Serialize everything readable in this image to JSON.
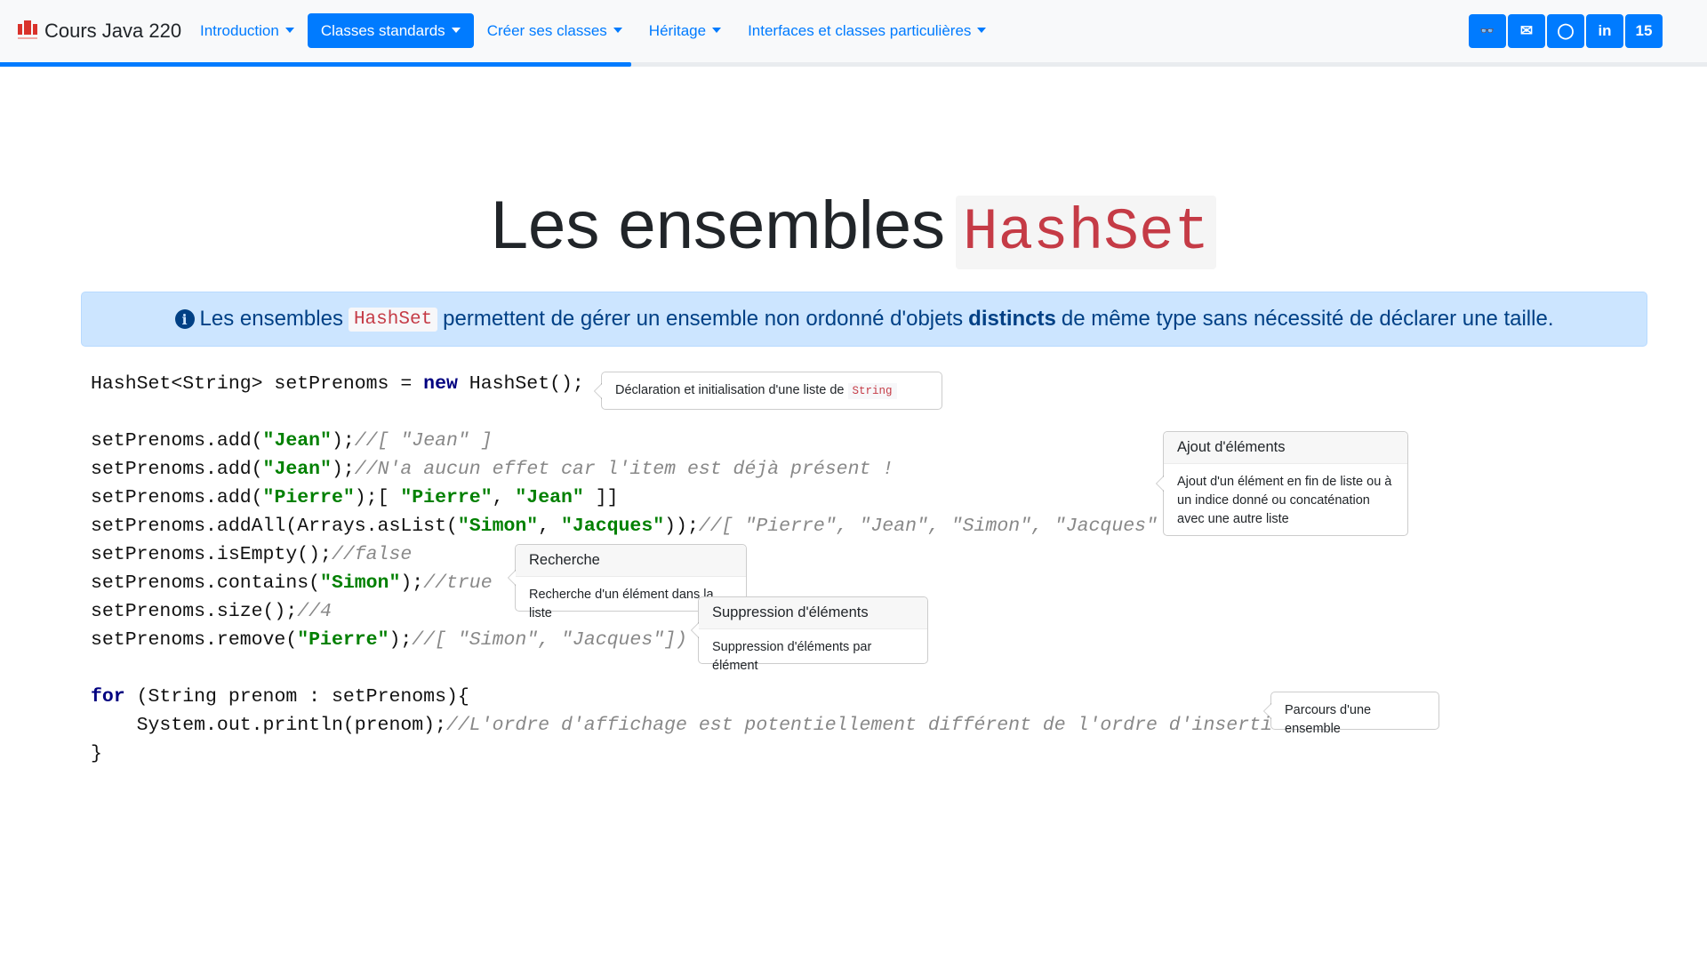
{
  "nav": {
    "brand": "Cours Java 220",
    "links": [
      {
        "label": "Introduction",
        "active": false
      },
      {
        "label": "Classes standards",
        "active": true
      },
      {
        "label": "Créer ses classes",
        "active": false
      },
      {
        "label": "Héritage",
        "active": false
      },
      {
        "label": "Interfaces et classes particulières",
        "active": false
      }
    ],
    "buttons": [
      {
        "icon": "glasses-icon",
        "glyph": "👓"
      },
      {
        "icon": "envelope-icon",
        "glyph": "✉"
      },
      {
        "icon": "github-icon",
        "glyph": "◯"
      },
      {
        "icon": "linkedin-icon",
        "glyph": "in"
      },
      {
        "icon": "page-number",
        "glyph": "15"
      }
    ],
    "progress_percent": 37,
    "accent": "#007bff"
  },
  "title": {
    "text": "Les ensembles",
    "code": "HashSet"
  },
  "alert": {
    "before": "Les ensembles",
    "code": "HashSet",
    "middle": "permettent de gérer un ensemble non ordonné d'objets",
    "bold": "distincts",
    "after": "de même type sans nécessité de déclarer une taille."
  },
  "code": [
    [
      [
        "t",
        "HashSet<String> setPrenoms = "
      ],
      [
        "kw",
        "new"
      ],
      [
        "t",
        " HashSet();"
      ]
    ],
    [],
    [
      [
        "t",
        "setPrenoms.add("
      ],
      [
        "str",
        "\"Jean\""
      ],
      [
        "t",
        ");"
      ],
      [
        "cm",
        "//[ \"Jean\" ]"
      ]
    ],
    [
      [
        "t",
        "setPrenoms.add("
      ],
      [
        "str",
        "\"Jean\""
      ],
      [
        "t",
        ");"
      ],
      [
        "cm",
        "//N'a aucun effet car l'item est déjà présent !"
      ]
    ],
    [
      [
        "t",
        "setPrenoms.add("
      ],
      [
        "str",
        "\"Pierre\""
      ],
      [
        "t",
        ");[ "
      ],
      [
        "str",
        "\"Pierre\""
      ],
      [
        "t",
        ", "
      ],
      [
        "str",
        "\"Jean\""
      ],
      [
        "t",
        " ]]"
      ]
    ],
    [
      [
        "t",
        "setPrenoms.addAll(Arrays.asList("
      ],
      [
        "str",
        "\"Simon\""
      ],
      [
        "t",
        ", "
      ],
      [
        "str",
        "\"Jacques\""
      ],
      [
        "t",
        "));"
      ],
      [
        "cm",
        "//[ \"Pierre\", \"Jean\", \"Simon\", \"Jacques\" ]"
      ]
    ],
    [
      [
        "t",
        "setPrenoms.isEmpty();"
      ],
      [
        "cm",
        "//false"
      ]
    ],
    [
      [
        "t",
        "setPrenoms.contains("
      ],
      [
        "str",
        "\"Simon\""
      ],
      [
        "t",
        ");"
      ],
      [
        "cm",
        "//true"
      ]
    ],
    [
      [
        "t",
        "setPrenoms.size();"
      ],
      [
        "cm",
        "//4"
      ]
    ],
    [
      [
        "t",
        "setPrenoms.remove("
      ],
      [
        "str",
        "\"Pierre\""
      ],
      [
        "t",
        ");"
      ],
      [
        "cm",
        "//[ \"Simon\", \"Jacques\"])"
      ]
    ],
    [],
    [
      [
        "kw",
        "for"
      ],
      [
        "t",
        " (String prenom : setPrenoms){"
      ]
    ],
    [
      [
        "t",
        "    System.out.println(prenom);"
      ],
      [
        "cm",
        "//L'ordre d'affichage est potentiellement différent de l'ordre d'insertion"
      ]
    ],
    [
      [
        "t",
        "}"
      ]
    ]
  ],
  "popovers": {
    "decl": {
      "text": "Déclaration et initialisation d'une liste de",
      "code": "String"
    },
    "ajout": {
      "title": "Ajout d'éléments",
      "body": "Ajout d'un élément en fin de liste ou à un indice donné ou concaténation avec une autre liste"
    },
    "recherche": {
      "title": "Recherche",
      "body": "Recherche d'un élément dans la liste"
    },
    "suppression": {
      "title": "Suppression d'éléments",
      "body": "Suppression d'éléments par élément"
    },
    "parcours": {
      "text": "Parcours d'une ensemble"
    }
  }
}
